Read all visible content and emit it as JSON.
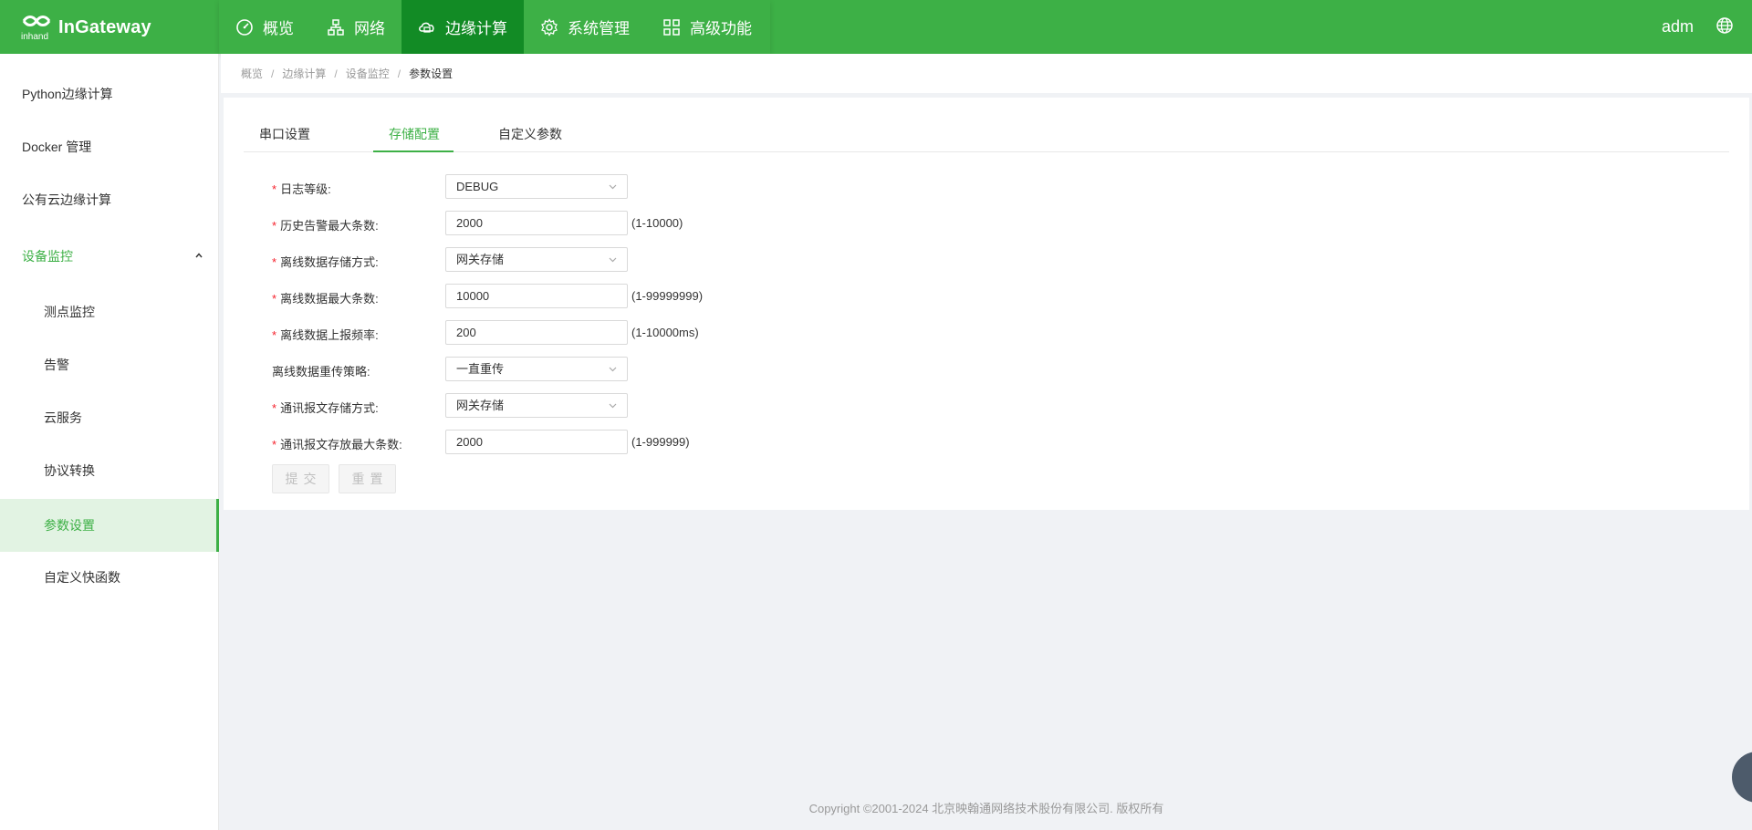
{
  "app": {
    "brand": "InGateway",
    "user": "adm"
  },
  "nav": [
    {
      "label": "概览",
      "icon": "dashboard-icon"
    },
    {
      "label": "网络",
      "icon": "network-icon"
    },
    {
      "label": "边缘计算",
      "icon": "edge-computing-icon",
      "active": true
    },
    {
      "label": "系统管理",
      "icon": "gear-icon"
    },
    {
      "label": "高级功能",
      "icon": "grid-icon"
    }
  ],
  "sidebar": {
    "items": [
      {
        "label": "Python边缘计算"
      },
      {
        "label": "Docker 管理"
      },
      {
        "label": "公有云边缘计算"
      },
      {
        "label": "设备监控",
        "expanded": true
      },
      {
        "label": "测点监控"
      },
      {
        "label": "告警"
      },
      {
        "label": "云服务"
      },
      {
        "label": "协议转换"
      },
      {
        "label": "参数设置",
        "active": true
      },
      {
        "label": "自定义快函数"
      }
    ]
  },
  "breadcrumb": [
    "概览",
    "边缘计算",
    "设备监控",
    "参数设置"
  ],
  "tabs": [
    {
      "label": "串口设置"
    },
    {
      "label": "存储配置",
      "active": true
    },
    {
      "label": "自定义参数"
    }
  ],
  "form": {
    "fields": [
      {
        "label": "日志等级:",
        "required": true,
        "type": "select",
        "value": "DEBUG"
      },
      {
        "label": "历史告警最大条数:",
        "required": true,
        "type": "input",
        "value": "2000",
        "range": "(1-10000)"
      },
      {
        "label": "离线数据存储方式:",
        "required": true,
        "type": "select",
        "value": "网关存储"
      },
      {
        "label": "离线数据最大条数:",
        "required": true,
        "type": "input",
        "value": "10000",
        "range": "(1-99999999)"
      },
      {
        "label": "离线数据上报频率:",
        "required": true,
        "type": "input",
        "value": "200",
        "range": "(1-10000ms)"
      },
      {
        "label": "离线数据重传策略:",
        "required": false,
        "type": "select",
        "value": "一直重传"
      },
      {
        "label": "通讯报文存储方式:",
        "required": true,
        "type": "select",
        "value": "网关存储"
      },
      {
        "label": "通讯报文存放最大条数:",
        "required": true,
        "type": "input",
        "value": "2000",
        "range": "(1-999999)"
      }
    ],
    "required_mark": "*",
    "submit_label": "提交",
    "reset_label": "重置"
  },
  "footer": {
    "copyright": "Copyright ©2001-2024 北京映翰通网络技术股份有限公司. 版权所有"
  },
  "colors": {
    "primary": "#3db046",
    "nav_active": "#128b25",
    "required": "#f5222d"
  }
}
